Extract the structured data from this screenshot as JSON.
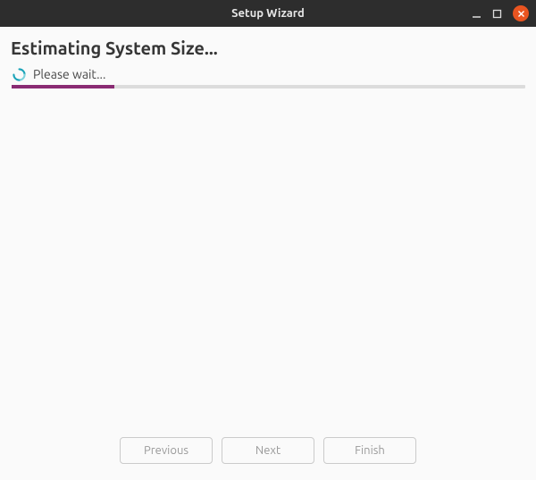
{
  "window": {
    "title": "Setup Wizard"
  },
  "header": {
    "heading": "Estimating System Size..."
  },
  "status": {
    "wait_text": "Please wait...",
    "progress_percent": 20
  },
  "buttons": {
    "previous": "Previous",
    "next": "Next",
    "finish": "Finish"
  }
}
